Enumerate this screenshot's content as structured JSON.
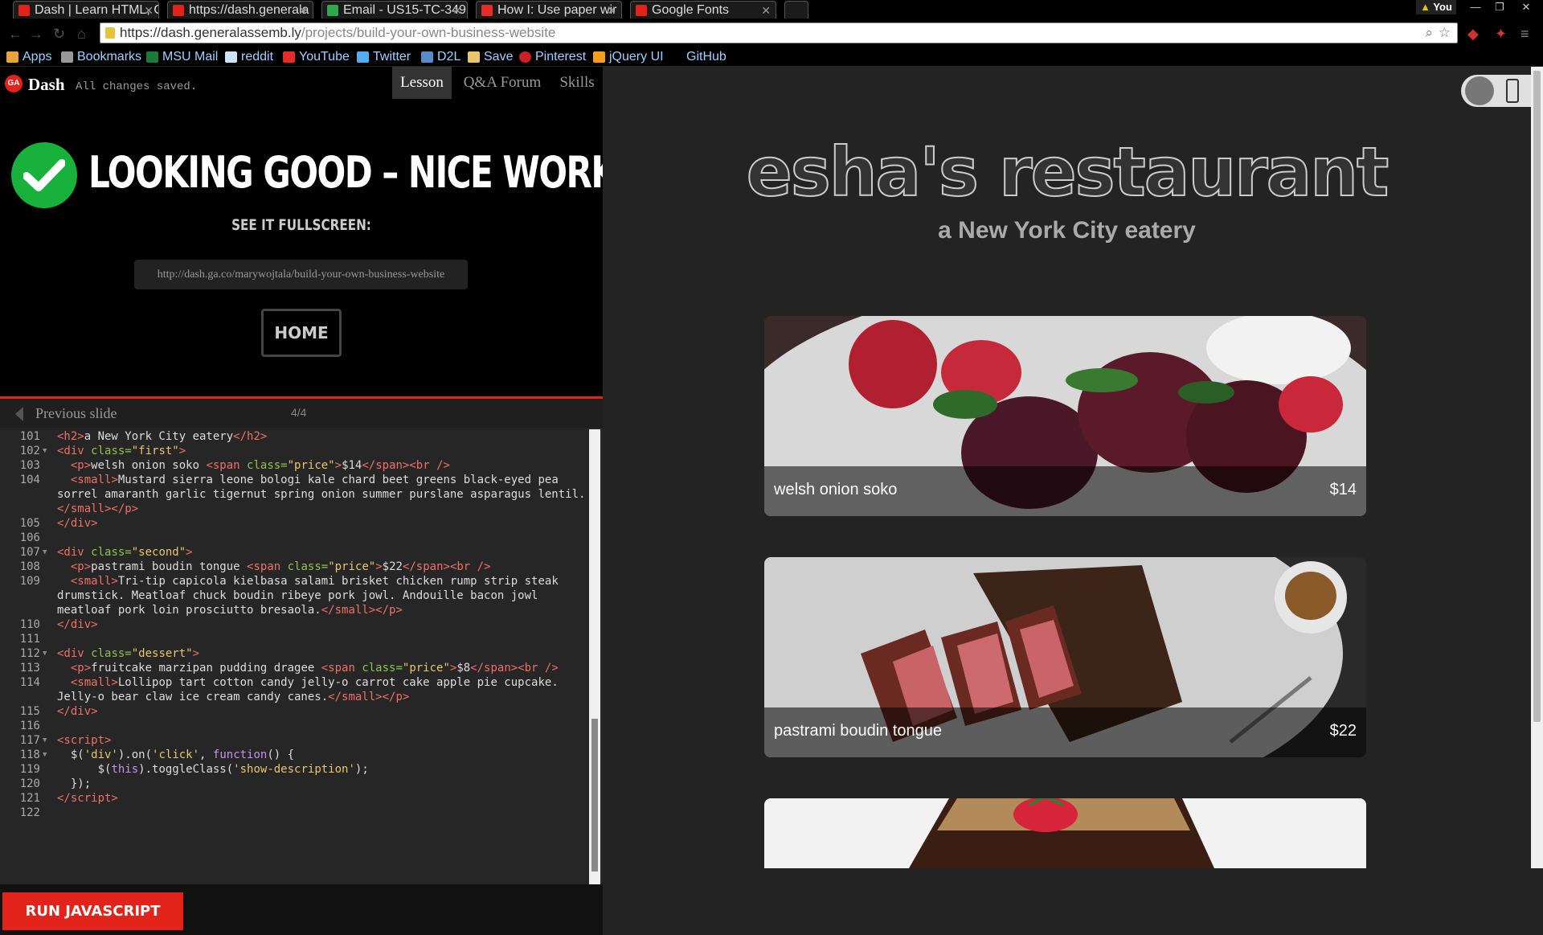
{
  "browser": {
    "tabs": [
      {
        "title": "Dash | Learn HTML, C",
        "color": "#e2231a"
      },
      {
        "title": "https://dash.generala",
        "color": "#e2231a"
      },
      {
        "title": "Email - US15-TC-349",
        "color": "#2fa84f"
      },
      {
        "title": "How I: Use paper wir",
        "color": "#e52d27"
      },
      {
        "title": "Google Fonts",
        "color": "#e2231a"
      }
    ],
    "profile_label": "You",
    "url_host": "https://dash.generalassemb.ly",
    "url_path": "/projects/build-your-own-business-website",
    "bookmarks": [
      {
        "label": "Apps",
        "icon": "apps-grid-icon"
      },
      {
        "label": "Bookmarks",
        "icon": "star-icon"
      },
      {
        "label": "MSU Mail",
        "icon": "msu-icon"
      },
      {
        "label": "reddit",
        "icon": "reddit-icon"
      },
      {
        "label": "YouTube",
        "icon": "youtube-icon"
      },
      {
        "label": "Twitter",
        "icon": "twitter-icon"
      },
      {
        "label": "D2L",
        "icon": "d2l-icon"
      },
      {
        "label": "Save",
        "icon": "folder-icon"
      },
      {
        "label": "Pinterest",
        "icon": "pinterest-icon"
      },
      {
        "label": "jQuery UI",
        "icon": "jquery-icon"
      },
      {
        "label": "GitHub",
        "icon": ""
      }
    ]
  },
  "dash": {
    "logo": "GA",
    "name": "Dash",
    "status": "All changes saved.",
    "tabs": [
      "Lesson",
      "Q&A Forum",
      "Skills"
    ],
    "success_title": "LOOKING GOOD – NICE WORK!",
    "see_fullscreen": "SEE IT FULLSCREEN:",
    "share_url": "http://dash.ga.co/marywojtala/build-your-own-business-website",
    "home_label": "HOME",
    "prev_label": "Previous slide",
    "slide_counter": "4/4",
    "run_label": "RUN JAVASCRIPT"
  },
  "code_lines": [
    {
      "n": "101",
      "fold": false,
      "html": "<span class=\"tg\">&lt;h2&gt;</span><span class=\"tx\">a New York City eatery</span><span class=\"tg\">&lt;/h2&gt;</span>"
    },
    {
      "n": "102",
      "fold": true,
      "html": "<span class=\"tg\">&lt;div </span><span class=\"at\">class=</span><span class=\"st\">\"first\"</span><span class=\"tg\">&gt;</span>"
    },
    {
      "n": "103",
      "fold": false,
      "html": "  <span class=\"tg\">&lt;p&gt;</span><span class=\"tx\">welsh onion soko </span><span class=\"tg\">&lt;span </span><span class=\"at\">class=</span><span class=\"st\">\"price\"</span><span class=\"tg\">&gt;</span><span class=\"tx\">$14</span><span class=\"tg\">&lt;/span&gt;&lt;br /&gt;</span>"
    },
    {
      "n": "104",
      "fold": false,
      "html": "  <span class=\"tg\">&lt;small&gt;</span><span class=\"tx\">Mustard sierra leone bologi kale chard beet greens black-eyed pea</span>"
    },
    {
      "n": "",
      "fold": false,
      "html": "<span class=\"tx\">sorrel amaranth garlic tigernut spring onion summer purslane asparagus lentil.</span>"
    },
    {
      "n": "",
      "fold": false,
      "html": "<span class=\"tg\">&lt;/small&gt;&lt;/p&gt;</span>"
    },
    {
      "n": "105",
      "fold": false,
      "html": "<span class=\"tg\">&lt;/div&gt;</span>"
    },
    {
      "n": "106",
      "fold": false,
      "html": ""
    },
    {
      "n": "107",
      "fold": true,
      "html": "<span class=\"tg\">&lt;div </span><span class=\"at\">class=</span><span class=\"st\">\"second\"</span><span class=\"tg\">&gt;</span>"
    },
    {
      "n": "108",
      "fold": false,
      "html": "  <span class=\"tg\">&lt;p&gt;</span><span class=\"tx\">pastrami boudin tongue </span><span class=\"tg\">&lt;span </span><span class=\"at\">class=</span><span class=\"st\">\"price\"</span><span class=\"tg\">&gt;</span><span class=\"tx\">$22</span><span class=\"tg\">&lt;/span&gt;&lt;br /&gt;</span>"
    },
    {
      "n": "109",
      "fold": false,
      "html": "  <span class=\"tg\">&lt;small&gt;</span><span class=\"tx\">Tri-tip capicola kielbasa salami brisket chicken rump strip steak</span>"
    },
    {
      "n": "",
      "fold": false,
      "html": "<span class=\"tx\">drumstick. Meatloaf chuck boudin ribeye pork jowl. Andouille bacon jowl</span>"
    },
    {
      "n": "",
      "fold": false,
      "html": "<span class=\"tx\">meatloaf pork loin prosciutto bresaola.</span><span class=\"tg\">&lt;/small&gt;&lt;/p&gt;</span>"
    },
    {
      "n": "110",
      "fold": false,
      "html": "<span class=\"tg\">&lt;/div&gt;</span>"
    },
    {
      "n": "111",
      "fold": false,
      "html": ""
    },
    {
      "n": "112",
      "fold": true,
      "html": "<span class=\"tg\">&lt;div </span><span class=\"at\">class=</span><span class=\"st\">\"dessert\"</span><span class=\"tg\">&gt;</span>"
    },
    {
      "n": "113",
      "fold": false,
      "html": "  <span class=\"tg\">&lt;p&gt;</span><span class=\"tx\">fruitcake marzipan pudding dragee </span><span class=\"tg\">&lt;span </span><span class=\"at\">class=</span><span class=\"st\">\"price\"</span><span class=\"tg\">&gt;</span><span class=\"tx\">$8</span><span class=\"tg\">&lt;/span&gt;&lt;br /&gt;</span>"
    },
    {
      "n": "114",
      "fold": false,
      "html": "  <span class=\"tg\">&lt;small&gt;</span><span class=\"tx\">Lollipop tart cotton candy jelly-o carrot cake apple pie cupcake.</span>"
    },
    {
      "n": "",
      "fold": false,
      "html": "<span class=\"tx\">Jelly-o bear claw ice cream candy canes.</span><span class=\"tg\">&lt;/small&gt;&lt;/p&gt;</span>"
    },
    {
      "n": "115",
      "fold": false,
      "html": "<span class=\"tg\">&lt;/div&gt;</span>"
    },
    {
      "n": "116",
      "fold": false,
      "html": ""
    },
    {
      "n": "117",
      "fold": true,
      "html": "<span class=\"tg\">&lt;script&gt;</span>"
    },
    {
      "n": "118",
      "fold": true,
      "html": "  <span class=\"tx\">$(</span><span class=\"st\">'div'</span><span class=\"tx\">).on(</span><span class=\"st\">'click'</span><span class=\"tx\">, </span><span class=\"fn\">function</span><span class=\"tx\">() {</span>"
    },
    {
      "n": "119",
      "fold": false,
      "html": "      <span class=\"tx\">$(</span><span class=\"fn\">this</span><span class=\"tx\">).toggleClass(</span><span class=\"st\">'show-description'</span><span class=\"tx\">);</span>"
    },
    {
      "n": "120",
      "fold": false,
      "html": "  <span class=\"tx\">});</span>"
    },
    {
      "n": "121",
      "fold": false,
      "html": "<span class=\"tg\">&lt;/script&gt;</span>"
    },
    {
      "n": "122",
      "fold": false,
      "html": ""
    }
  ],
  "preview": {
    "restaurant_name": "esha's restaurant",
    "subtitle": "a New York City eatery",
    "dishes": [
      {
        "name": "welsh onion soko",
        "price": "$14",
        "image": "beet-salad-image"
      },
      {
        "name": "pastrami boudin tongue",
        "price": "$22",
        "image": "sliced-steak-image"
      },
      {
        "name": "",
        "price": "",
        "image": "chocolate-cake-image"
      }
    ]
  }
}
